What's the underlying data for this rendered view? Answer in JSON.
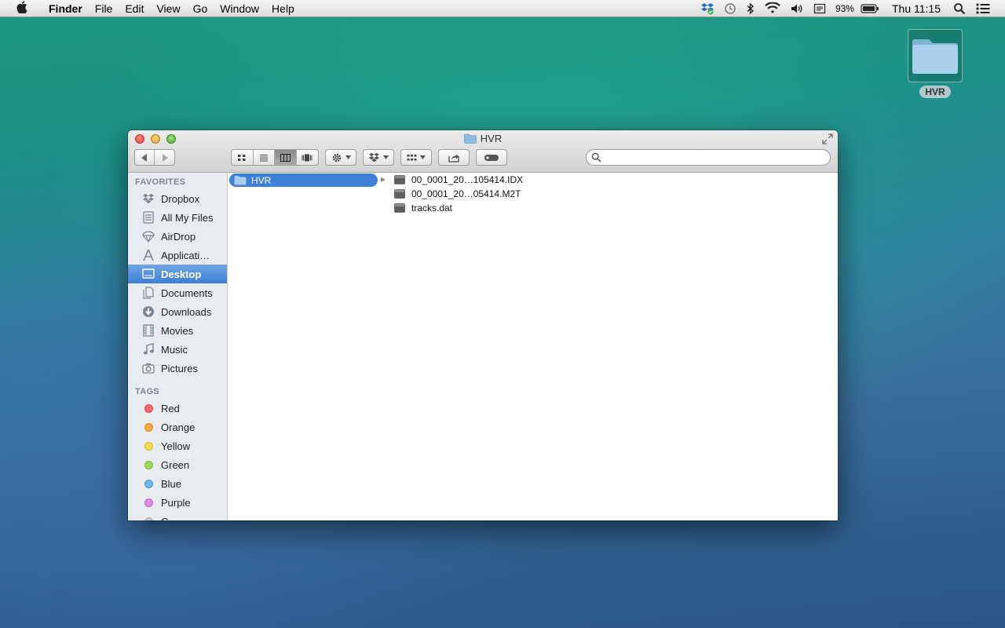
{
  "menubar": {
    "app": "Finder",
    "items": [
      "File",
      "Edit",
      "View",
      "Go",
      "Window",
      "Help"
    ],
    "battery": "93%",
    "clock": "Thu 11:15"
  },
  "desktop": {
    "icon_label": "HVR"
  },
  "window": {
    "title": "HVR",
    "search_placeholder": ""
  },
  "sidebar": {
    "favorites_heading": "FAVORITES",
    "favorites": [
      {
        "label": "Dropbox",
        "icon": "dropbox-icon"
      },
      {
        "label": "All My Files",
        "icon": "all-my-files-icon"
      },
      {
        "label": "AirDrop",
        "icon": "airdrop-icon"
      },
      {
        "label": "Applicati…",
        "icon": "applications-icon"
      },
      {
        "label": "Desktop",
        "icon": "desktop-icon",
        "selected": true
      },
      {
        "label": "Documents",
        "icon": "documents-icon"
      },
      {
        "label": "Downloads",
        "icon": "downloads-icon"
      },
      {
        "label": "Movies",
        "icon": "movies-icon"
      },
      {
        "label": "Music",
        "icon": "music-icon"
      },
      {
        "label": "Pictures",
        "icon": "pictures-icon"
      }
    ],
    "tags_heading": "TAGS",
    "tags": [
      {
        "label": "Red",
        "color": "#f26a6a",
        "border": "#d94c4c"
      },
      {
        "label": "Orange",
        "color": "#f6a83c",
        "border": "#d88a22"
      },
      {
        "label": "Yellow",
        "color": "#f4dd4c",
        "border": "#d4bb2e"
      },
      {
        "label": "Green",
        "color": "#9fd65a",
        "border": "#7eb73e"
      },
      {
        "label": "Blue",
        "color": "#6ab8ee",
        "border": "#4a98d2"
      },
      {
        "label": "Purple",
        "color": "#e08ae6",
        "border": "#c26ac8"
      },
      {
        "label": "G",
        "color": "#c8c8c8",
        "border": "#a8a8a8"
      }
    ]
  },
  "columns": {
    "col1": [
      {
        "label": "HVR",
        "selected": true
      }
    ],
    "col2": [
      {
        "label": "00_0001_20…105414.IDX"
      },
      {
        "label": "00_0001_20…05414.M2T"
      },
      {
        "label": "tracks.dat"
      }
    ]
  }
}
